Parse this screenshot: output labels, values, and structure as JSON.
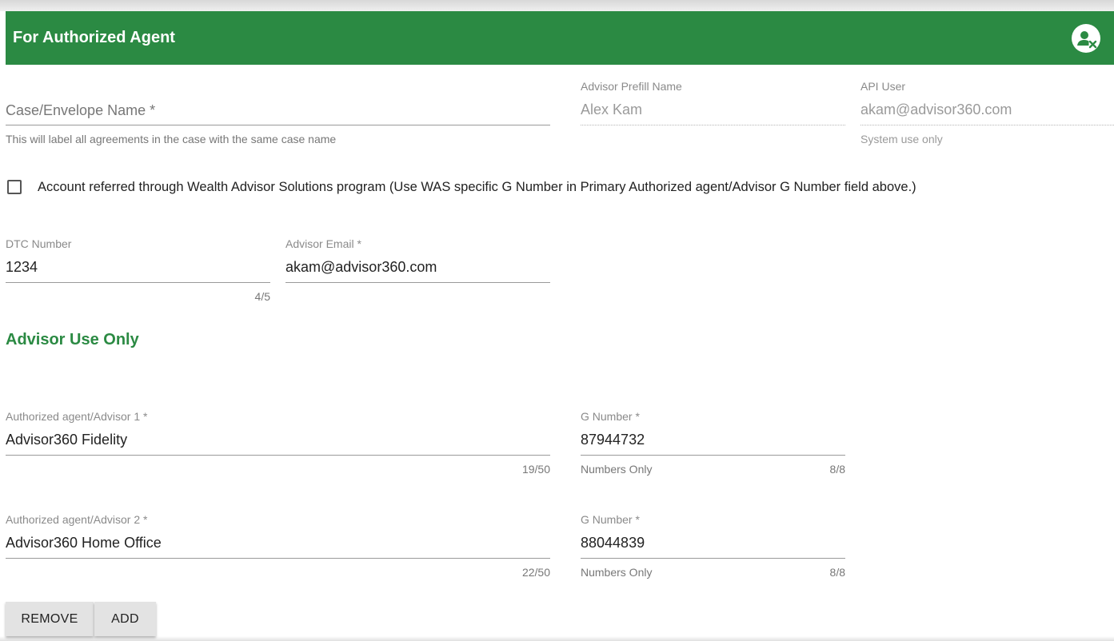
{
  "header": {
    "title": "For Authorized Agent",
    "icon": "remove-user-icon",
    "color": "#2b8a43"
  },
  "case_name": {
    "placeholder": "Case/Envelope Name",
    "required_mark": "*",
    "hint": "This will label all agreements in the case with the same case name"
  },
  "advisor_prefill": {
    "label": "Advisor Prefill Name",
    "value": "Alex Kam"
  },
  "api_user": {
    "label": "API User",
    "value": "akam@advisor360.com",
    "hint": "System use only"
  },
  "was_checkbox": {
    "checked": false,
    "label": "Account referred through Wealth Advisor Solutions program (Use WAS specific G Number in Primary Authorized agent/Advisor G Number field above.)"
  },
  "dtc": {
    "label": "DTC Number",
    "value": "1234",
    "counter": "4/5"
  },
  "advisor_email": {
    "label": "Advisor Email *",
    "value": "akam@advisor360.com"
  },
  "section_title": "Advisor Use Only",
  "agents": [
    {
      "label": "Authorized agent/Advisor 1 *",
      "value": "Advisor360 Fidelity",
      "counter": "19/50",
      "g_label": "G Number *",
      "g_value": "87944732",
      "g_hint": "Numbers Only",
      "g_counter": "8/8"
    },
    {
      "label": "Authorized agent/Advisor 2 *",
      "value": "Advisor360 Home Office",
      "counter": "22/50",
      "g_label": "G Number *",
      "g_value": "88044839",
      "g_hint": "Numbers Only",
      "g_counter": "8/8"
    }
  ],
  "buttons": {
    "remove": "REMOVE",
    "add": "ADD"
  }
}
